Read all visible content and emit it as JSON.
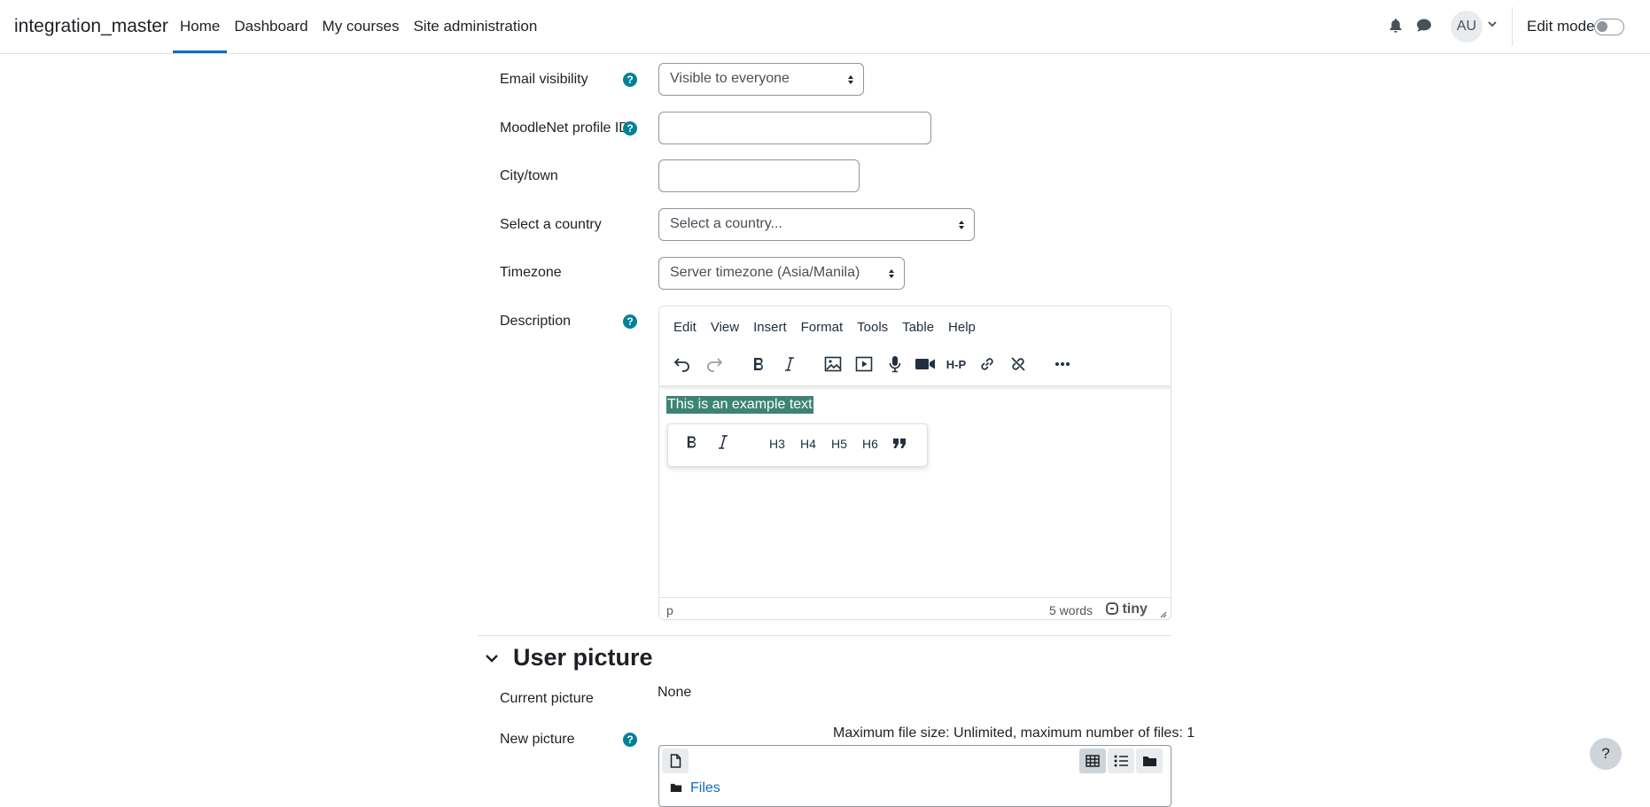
{
  "navbar": {
    "brand": "integration_master",
    "items": [
      {
        "label": "Home",
        "active": true
      },
      {
        "label": "Dashboard",
        "active": false
      },
      {
        "label": "My courses",
        "active": false
      },
      {
        "label": "Site administration",
        "active": false
      }
    ],
    "avatar_initials": "AU",
    "edit_mode_label": "Edit mode",
    "edit_mode_on": false,
    "accent_color": "#0f6cbf"
  },
  "form": {
    "email_visibility": {
      "label": "Email visibility",
      "value": "Visible to everyone"
    },
    "moodlenet": {
      "label": "MoodleNet profile ID",
      "value": ""
    },
    "city": {
      "label": "City/town",
      "value": ""
    },
    "country": {
      "label": "Select a country",
      "value": "Select a country..."
    },
    "timezone": {
      "label": "Timezone",
      "value": "Server timezone (Asia/Manila)"
    },
    "description": {
      "label": "Description"
    },
    "help_glyph": "?"
  },
  "editor": {
    "menu": [
      "Edit",
      "View",
      "Insert",
      "Format",
      "Tools",
      "Table",
      "Help"
    ],
    "toolbar_icons": [
      "undo-icon",
      "redo-icon",
      "bold-icon",
      "italic-icon",
      "image-icon",
      "media-icon",
      "microphone-icon",
      "video-camera-icon",
      "h5p-icon",
      "link-icon",
      "unlink-icon",
      "more-icon"
    ],
    "content": "This is an example text",
    "quickbar": {
      "bold": "B",
      "italic": "I",
      "h3": "H3",
      "h4": "H4",
      "h5": "H5",
      "h6": "H6"
    },
    "status_path": "p",
    "word_count": "5 words",
    "brand": "tiny",
    "highlight_color": "#3d8475"
  },
  "user_picture": {
    "section_title": "User picture",
    "current_label": "Current picture",
    "current_value": "None",
    "new_label": "New picture",
    "max_size": "Maximum file size: Unlimited, maximum number of files: 1",
    "files_label": "Files"
  },
  "help_fab": "?"
}
